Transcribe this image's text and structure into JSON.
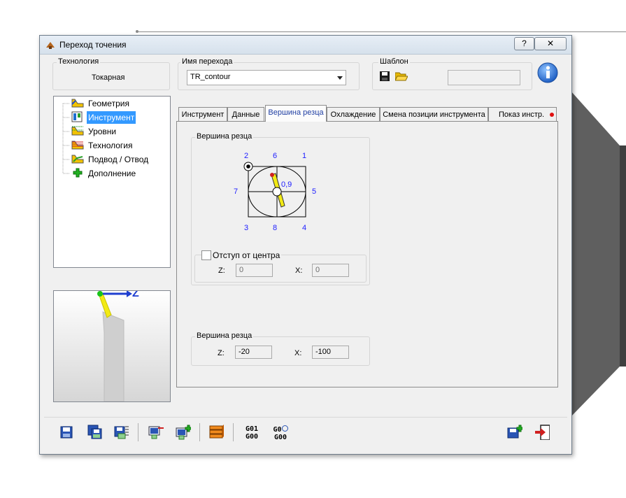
{
  "dialog": {
    "title": "Переход точения",
    "help_label": "?",
    "close_label": "✕"
  },
  "technology": {
    "group_label": "Технология",
    "value": "Токарная"
  },
  "transition_name": {
    "group_label": "Имя перехода",
    "value": "TR_contour"
  },
  "template": {
    "group_label": "Шаблон"
  },
  "tree": {
    "items": [
      {
        "label": "Геометрия",
        "icon": "geometry-icon"
      },
      {
        "label": "Инструмент",
        "icon": "tool-icon",
        "selected": true
      },
      {
        "label": "Уровни",
        "icon": "levels-icon"
      },
      {
        "label": "Технология",
        "icon": "technology-icon"
      },
      {
        "label": "Подвод / Отвод",
        "icon": "approach-icon"
      },
      {
        "label": "Дополнение",
        "icon": "plus-icon"
      }
    ]
  },
  "preview": {
    "axis_label": "Z"
  },
  "tabs": [
    {
      "label": "Инструмент"
    },
    {
      "label": "Данные"
    },
    {
      "label": "Вершина резца",
      "active": true
    },
    {
      "label": "Охлаждение"
    },
    {
      "label": "Смена позиции инструмента"
    },
    {
      "label": "Показ инстр."
    }
  ],
  "tip_diagram": {
    "group_label": "Вершина резца",
    "numbers": {
      "n2": "2",
      "n6": "6",
      "n1": "1",
      "n7": "7",
      "n5": "5",
      "n3": "3",
      "n8": "8",
      "n4": "4"
    },
    "radius_label": "0,9"
  },
  "offset": {
    "checkbox_label": "Отступ от центра",
    "checked": false,
    "z_label": "Z:",
    "z_value": "0",
    "x_label": "X:",
    "x_value": "0"
  },
  "tip_coords": {
    "group_label": "Вершина резца",
    "z_label": "Z:",
    "z_value": "-20",
    "x_label": "X:",
    "x_value": "-100"
  },
  "bottom_toolbar": {
    "g_codes_1": {
      "top": "G01",
      "bottom": "G00"
    },
    "g_codes_2": {
      "top": "G0",
      "bottom": "G00"
    }
  },
  "colors": {
    "accent": "#1f3ea3",
    "selection": "#3399ff",
    "insert_yellow": "#f2ea14",
    "diagram_blue": "#2020ff"
  }
}
